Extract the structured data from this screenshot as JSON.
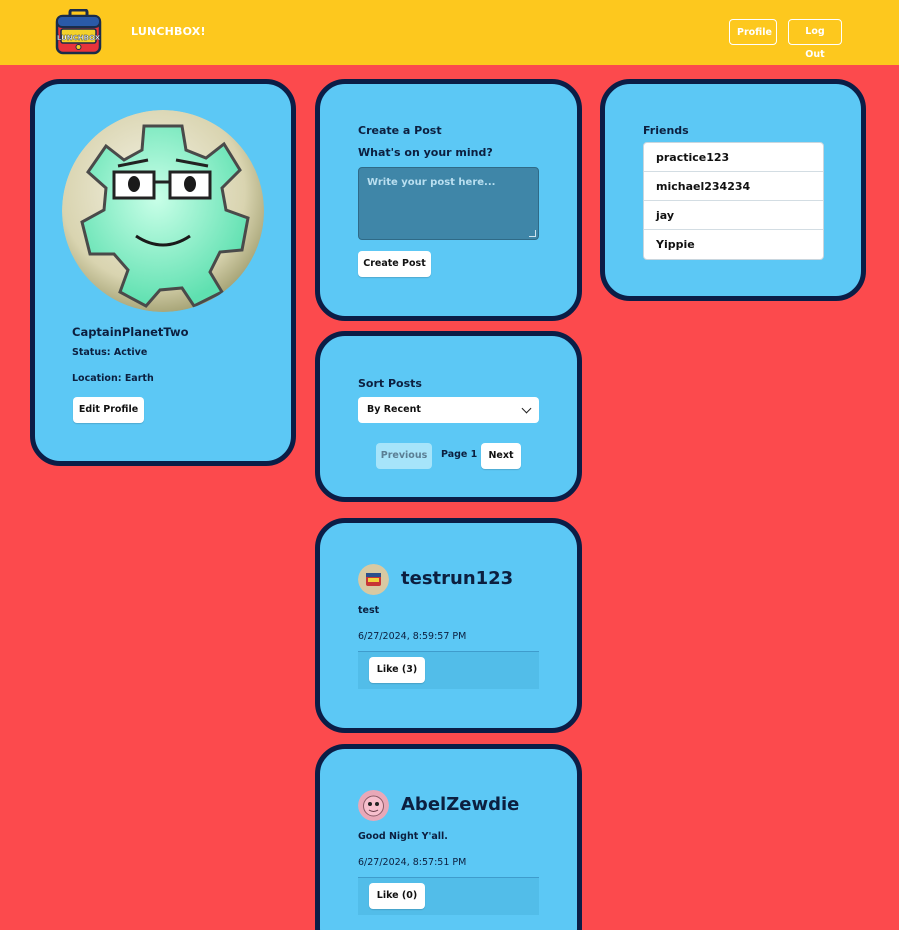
{
  "header": {
    "logo_text": "LUNCHBOX",
    "brand": "LUNCHBOX!",
    "profile_label": "Profile",
    "logout_label": "Log Out",
    "bg_color": "#fdc81e"
  },
  "colors": {
    "page_bg": "#fc4a4d",
    "card_bg": "#5cc8f5",
    "card_border": "#0b1d46"
  },
  "profile": {
    "username": "CaptainPlanetTwo",
    "status": "Status: Active",
    "location": "Location: Earth",
    "edit_label": "Edit Profile"
  },
  "create_post": {
    "title": "Create a Post",
    "prompt": "What's on your mind?",
    "placeholder": "Write your post here...",
    "submit_label": "Create Post"
  },
  "friends": {
    "title": "Friends",
    "items": [
      "practice123",
      "michael234234",
      "jay",
      "Yippie"
    ]
  },
  "sort": {
    "title": "Sort Posts",
    "selected": "By Recent",
    "prev_label": "Previous",
    "page_label": "Page 1",
    "next_label": "Next"
  },
  "posts": [
    {
      "username": "testrun123",
      "body": "test",
      "time": "6/27/2024, 8:59:57 PM",
      "like_label": "Like (3)"
    },
    {
      "username": "AbelZewdie",
      "body": "Good Night Y'all.",
      "time": "6/27/2024, 8:57:51 PM",
      "like_label": "Like (0)"
    }
  ]
}
